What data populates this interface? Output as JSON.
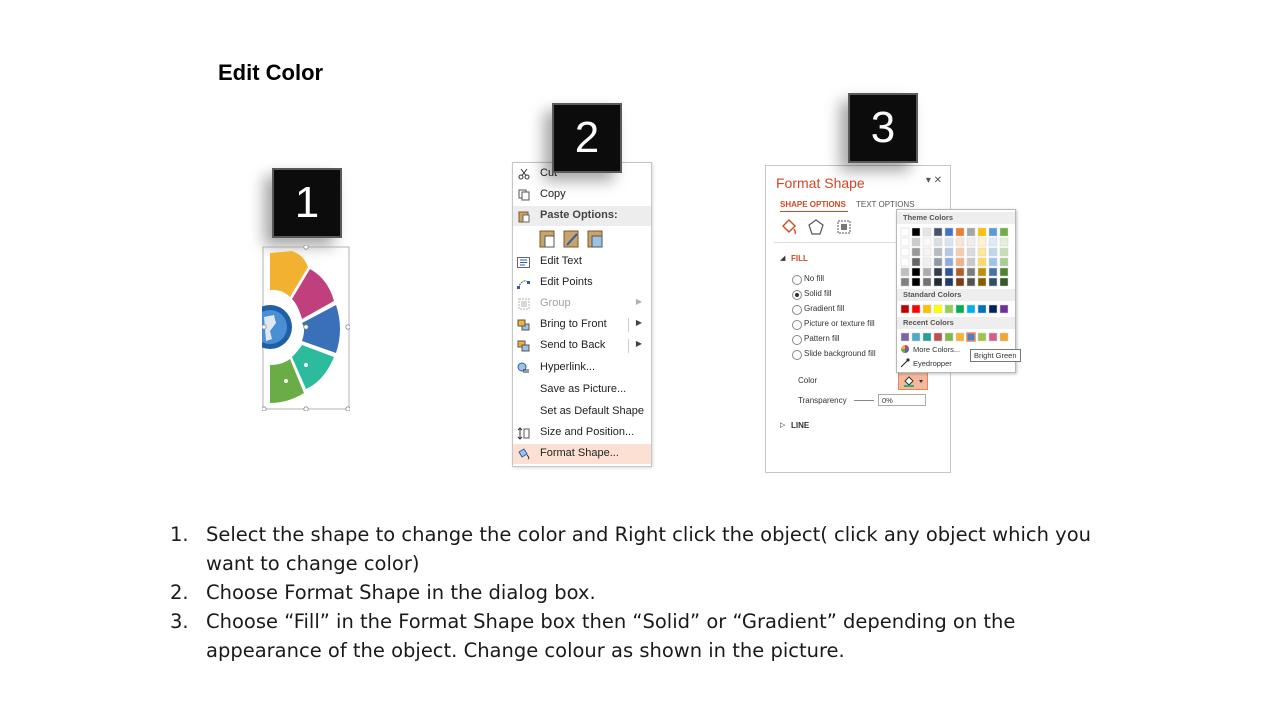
{
  "slide": {
    "title": "Edit Color"
  },
  "badges": [
    "1",
    "2",
    "3"
  ],
  "context_menu": {
    "items": [
      {
        "label": "Cut",
        "icon": "scissors-icon",
        "type": "item"
      },
      {
        "label": "Copy",
        "icon": "copy-icon",
        "type": "item"
      },
      {
        "label": "Paste Options:",
        "icon": "paste-icon",
        "type": "header"
      },
      {
        "label": "",
        "icon": "paste-variants-icon",
        "type": "paste-row"
      },
      {
        "label": "Edit Text",
        "icon": "edit-text-icon",
        "type": "item"
      },
      {
        "label": "Edit Points",
        "icon": "edit-points-icon",
        "type": "item"
      },
      {
        "label": "Group",
        "icon": "group-icon",
        "type": "disabled",
        "submenu": true
      },
      {
        "label": "Bring to Front",
        "icon": "bring-front-icon",
        "type": "item",
        "submenu": true
      },
      {
        "label": "Send to Back",
        "icon": "send-back-icon",
        "type": "item",
        "submenu": true
      },
      {
        "label": "Hyperlink...",
        "icon": "hyperlink-icon",
        "type": "item"
      },
      {
        "label": "Save as Picture...",
        "icon": "",
        "type": "item"
      },
      {
        "label": "Set as Default Shape",
        "icon": "",
        "type": "item"
      },
      {
        "label": "Size and Position...",
        "icon": "size-position-icon",
        "type": "item"
      },
      {
        "label": "Format Shape...",
        "icon": "format-shape-icon",
        "type": "highlight"
      }
    ]
  },
  "format_pane": {
    "title": "Format Shape",
    "controls": "▾ ✕",
    "tabs": [
      "SHAPE OPTIONS",
      "TEXT OPTIONS"
    ],
    "fill_header": "FILL",
    "fill_options": [
      {
        "label": "No fill",
        "selected": false
      },
      {
        "label": "Solid fill",
        "selected": true
      },
      {
        "label": "Gradient fill",
        "selected": false
      },
      {
        "label": "Picture or texture fill",
        "selected": false
      },
      {
        "label": "Pattern fill",
        "selected": false
      },
      {
        "label": "Slide background fill",
        "selected": false
      }
    ],
    "color_label": "Color",
    "transparency_label": "Transparency",
    "transparency_value": "0%",
    "line_header": "LINE"
  },
  "palette": {
    "theme_title": "Theme Colors",
    "standard_title": "Standard Colors",
    "recent_title": "Recent Colors",
    "more_colors": "More Colors...",
    "eyedropper": "Eyedropper",
    "tooltip": "Bright Green",
    "theme_top": [
      "#ffffff",
      "#000000",
      "#e7e6e6",
      "#44546a",
      "#4472c4",
      "#ed7d31",
      "#a5a5a5",
      "#ffc000",
      "#5b9bd5",
      "#70ad47"
    ],
    "standard": [
      "#c00000",
      "#ff0000",
      "#ffc000",
      "#ffff00",
      "#92d050",
      "#00b050",
      "#00b0f0",
      "#0070c0",
      "#002060",
      "#7030a0"
    ],
    "recent": [
      "#8064a2",
      "#4aacc6",
      "#2b9c9c",
      "#c0504d",
      "#7dba4c",
      "#f5b335",
      "#4f81bd",
      "#9ec44a",
      "#d85c8b",
      "#f0a830"
    ]
  },
  "instructions": [
    "Select the shape to change the color and Right click the object( click any object which you want to change color)",
    "Choose Format Shape in the dialog box.",
    "Choose “Fill” in the Format Shape box then “Solid” or “Gradient” depending on the appearance of the object. Change colour as shown in the picture."
  ]
}
